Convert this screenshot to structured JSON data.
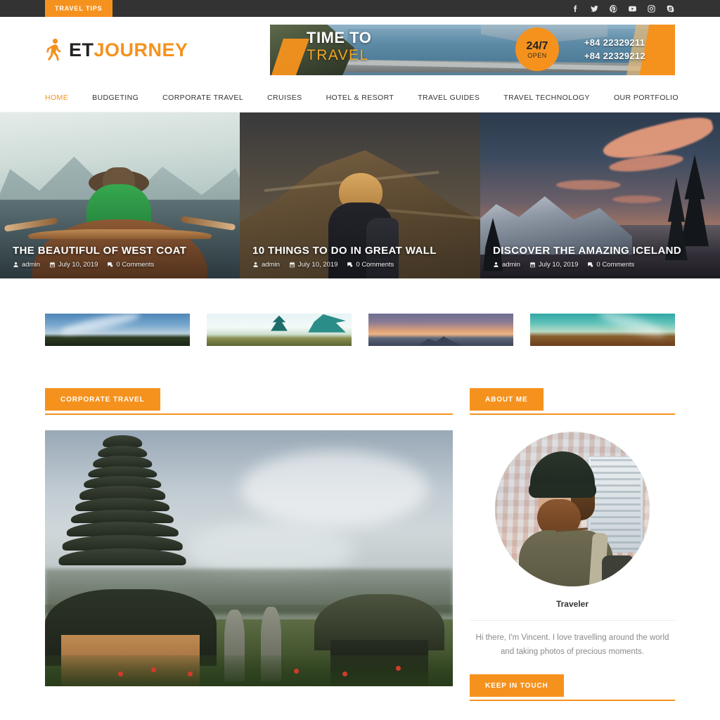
{
  "topbar": {
    "tab_label": "TRAVEL TIPS",
    "social": [
      {
        "name": "facebook-icon",
        "label": "Facebook"
      },
      {
        "name": "twitter-icon",
        "label": "Twitter"
      },
      {
        "name": "pinterest-icon",
        "label": "Pinterest"
      },
      {
        "name": "youtube-icon",
        "label": "YouTube"
      },
      {
        "name": "instagram-icon",
        "label": "Instagram"
      },
      {
        "name": "skype-icon",
        "label": "Skype"
      }
    ]
  },
  "header": {
    "logo_primary": "ET",
    "logo_secondary": "JOURNEY",
    "banner": {
      "line1": "TIME TO",
      "line2": "TRAVEL",
      "badge_top": "24/7",
      "badge_bottom": "OPEN",
      "phone1": "+84 22329211",
      "phone2": "+84 22329212"
    }
  },
  "nav": {
    "items": [
      {
        "label": "HOME",
        "active": true
      },
      {
        "label": "BUDGETING",
        "active": false
      },
      {
        "label": "CORPORATE TRAVEL",
        "active": false
      },
      {
        "label": "CRUISES",
        "active": false
      },
      {
        "label": "HOTEL & RESORT",
        "active": false
      },
      {
        "label": "TRAVEL GUIDES",
        "active": false
      },
      {
        "label": "TRAVEL TECHNOLOGY",
        "active": false
      },
      {
        "label": "OUR PORTFOLIO",
        "active": false
      }
    ]
  },
  "hero": {
    "slides": [
      {
        "title": "THE BEAUTIFUL OF WEST COAT",
        "author": "admin",
        "date": "July 10, 2019",
        "comments": "0 Comments"
      },
      {
        "title": "10 THINGS TO DO IN GREAT WALL",
        "author": "admin",
        "date": "July 10, 2019",
        "comments": "0 Comments"
      },
      {
        "title": "DISCOVER THE AMAZING ICELAND",
        "author": "admin",
        "date": "July 10, 2019",
        "comments": "0 Comments"
      }
    ]
  },
  "thumbstrip": {
    "items": [
      {
        "alt": "clouds over field"
      },
      {
        "alt": "palm trees"
      },
      {
        "alt": "sunset city skyline"
      },
      {
        "alt": "teal sky over desert"
      }
    ]
  },
  "main": {
    "section_title": "CORPORATE TRAVEL",
    "featured_image_alt": "Balinese temple pagoda in the mist"
  },
  "sidebar": {
    "about_title": "ABOUT ME",
    "avatar_alt": "Vincent, traveler portrait",
    "role": "Traveler",
    "bio": "Hi there, I'm Vincent. I love travelling around the world and taking photos of precious moments.",
    "keep_in_touch_title": "KEEP IN TOUCH"
  },
  "colors": {
    "accent": "#F5921E",
    "topbar_bg": "#333333",
    "text_dark": "#333333",
    "text_muted": "#8A8A8A"
  }
}
